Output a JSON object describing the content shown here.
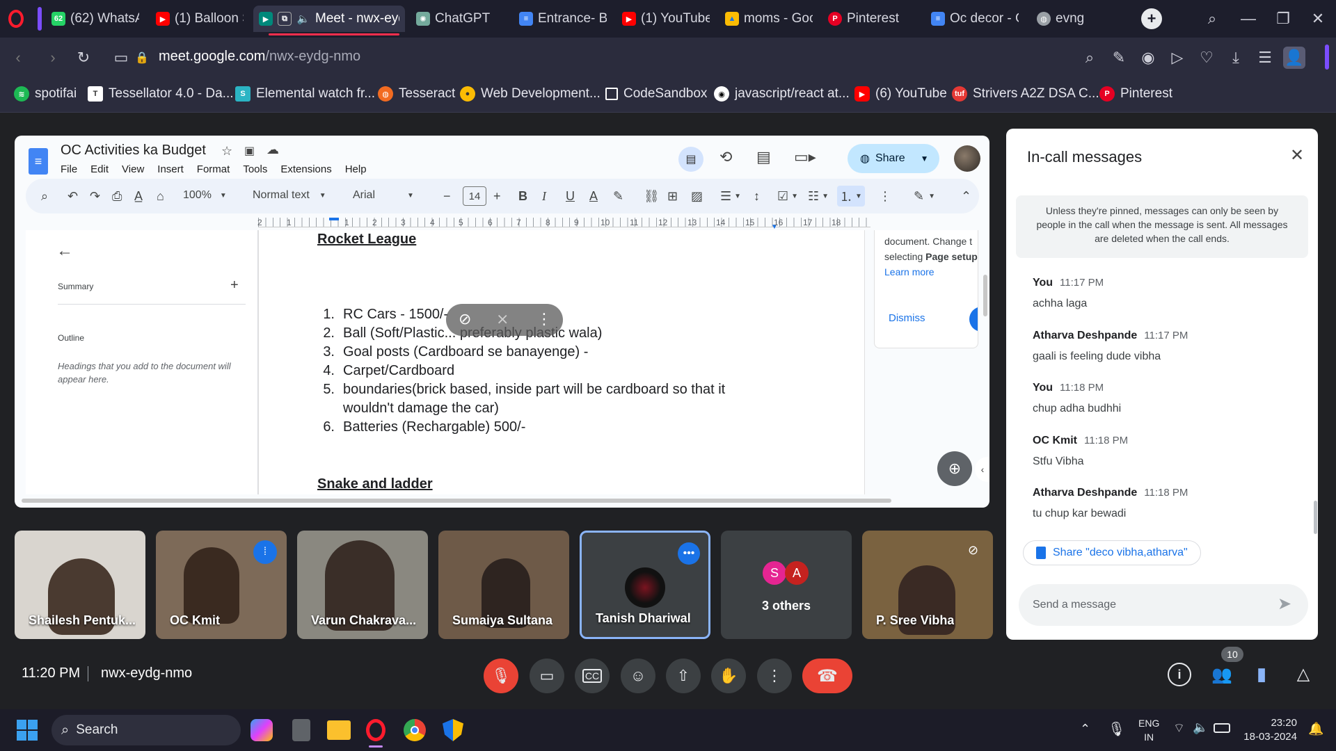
{
  "browser": {
    "tabs": [
      {
        "label": "(62) WhatsAp",
        "icon": "whatsapp-icon",
        "color": "#25d366",
        "badge": "62"
      },
      {
        "label": "(1) Balloon Sh",
        "icon": "youtube-icon",
        "color": "#ff0000"
      },
      {
        "label": "Meet - nwx-eyd",
        "icon": "meet-icon",
        "color": "#00897b"
      },
      {
        "label": "ChatGPT",
        "icon": "chatgpt-icon",
        "color": "#74aa9c"
      },
      {
        "label": "Entrance- Bo",
        "icon": "docs-icon",
        "color": "#4285f4"
      },
      {
        "label": "(1) YouTube",
        "icon": "youtube-icon",
        "color": "#ff0000"
      },
      {
        "label": "moms - Goo",
        "icon": "drive-icon",
        "color": "#fbbc04"
      },
      {
        "label": "Pinterest",
        "icon": "pinterest-icon",
        "color": "#e60023"
      },
      {
        "label": "Oc decor - G",
        "icon": "docs-icon",
        "color": "#4285f4"
      },
      {
        "label": "evng",
        "icon": "globe-icon",
        "color": "#9aa0a6"
      }
    ],
    "url_domain": "meet.google.com",
    "url_path": "/nwx-eydg-nmo",
    "bookmarks": [
      {
        "label": "spotifai",
        "color": "#1db954"
      },
      {
        "label": "Tessellator 4.0 - Da...",
        "color": "#ffffff"
      },
      {
        "label": "Elemental watch fr...",
        "color": "#2bb4c4"
      },
      {
        "label": "Tesseract",
        "color": "#f26b21"
      },
      {
        "label": "Web Development...",
        "color": "#fbbc04"
      },
      {
        "label": "CodeSandbox",
        "color": "#ffffff"
      },
      {
        "label": "javascript/react at...",
        "color": "#ffffff"
      },
      {
        "label": "(6) YouTube",
        "color": "#ff0000"
      },
      {
        "label": "Strivers A2Z DSA C...",
        "color": "#e53935"
      },
      {
        "label": "Pinterest",
        "color": "#e60023"
      }
    ]
  },
  "doc": {
    "title": "OC Activities ka Budget",
    "menu": [
      "File",
      "Edit",
      "View",
      "Insert",
      "Format",
      "Tools",
      "Extensions",
      "Help"
    ],
    "share_label": "Share",
    "zoom": "100%",
    "style": "Normal text",
    "font": "Arial",
    "font_size": "14",
    "ruler": [
      "2",
      "1",
      "1",
      "2",
      "3",
      "4",
      "5",
      "6",
      "7",
      "8",
      "9",
      "10",
      "11",
      "12",
      "13",
      "14",
      "15",
      "16",
      "17",
      "18"
    ],
    "sidebar": {
      "summary": "Summary",
      "outline": "Outline",
      "outline_hint": "Headings that you add to the document will appear here."
    },
    "heading1": "Rocket League",
    "list": [
      "RC Cars - 1500/-",
      "Ball (Soft/Plastic... preferably plastic wala)",
      "Goal posts (Cardboard se banayenge) -",
      "Carpet/Cardboard",
      "boundaries(brick based, inside part will be cardboard so that it",
      "wouldn't damage the car)",
      "Batteries (Rechargable) 500/-"
    ],
    "heading2": "Snake and ladder",
    "tip": {
      "line1": "document. Change t",
      "line2_pre": "selecting ",
      "line2_bold": "Page setup",
      "learn_more": "Learn more",
      "dismiss": "Dismiss"
    }
  },
  "incall": {
    "title": "In-call messages",
    "notice": "Unless they're pinned, messages can only be seen by people in the call when the message is sent. All messages are deleted when the call ends.",
    "messages": [
      {
        "sender": "You",
        "time": "11:17 PM",
        "text": "achha laga"
      },
      {
        "sender": "Atharva Deshpande",
        "time": "11:17 PM",
        "text": "gaali is feeling dude vibha"
      },
      {
        "sender": "You",
        "time": "11:18 PM",
        "text": "chup adha budhhi"
      },
      {
        "sender": "OC Kmit",
        "time": "11:18 PM",
        "text": "Stfu Vibha"
      },
      {
        "sender": "Atharva Deshpande",
        "time": "11:18 PM",
        "text": "tu chup kar bewadi"
      }
    ],
    "share_chip": "Share \"deco vibha,atharva\"",
    "input_placeholder": "Send a message"
  },
  "participants": [
    {
      "name": "Shailesh Pentuk...",
      "bg": "#d9d5cf"
    },
    {
      "name": "OC Kmit",
      "bg": "#7d6a58"
    },
    {
      "name": "Varun Chakrava...",
      "bg": "#8a8880"
    },
    {
      "name": "Sumaiya Sultana",
      "bg": "#6e5a48"
    },
    {
      "name": "Tanish Dhariwal",
      "bg": "#3c4043"
    },
    {
      "name": "3 others",
      "bg": "#3c4043",
      "avatars": [
        "S",
        "A"
      ]
    },
    {
      "name": "P. Sree Vibha",
      "bg": "#7a6240"
    }
  ],
  "meeting": {
    "time": "11:20 PM",
    "code": "nwx-eydg-nmo",
    "participant_count": "10"
  },
  "taskbar": {
    "search": "Search",
    "lang1": "ENG",
    "lang2": "IN",
    "clock_time": "23:20",
    "clock_date": "18-03-2024"
  },
  "colors": {
    "meet_red": "#ea4335",
    "accent_blue": "#8ab4f8",
    "docs_blue": "#1a73e8"
  }
}
